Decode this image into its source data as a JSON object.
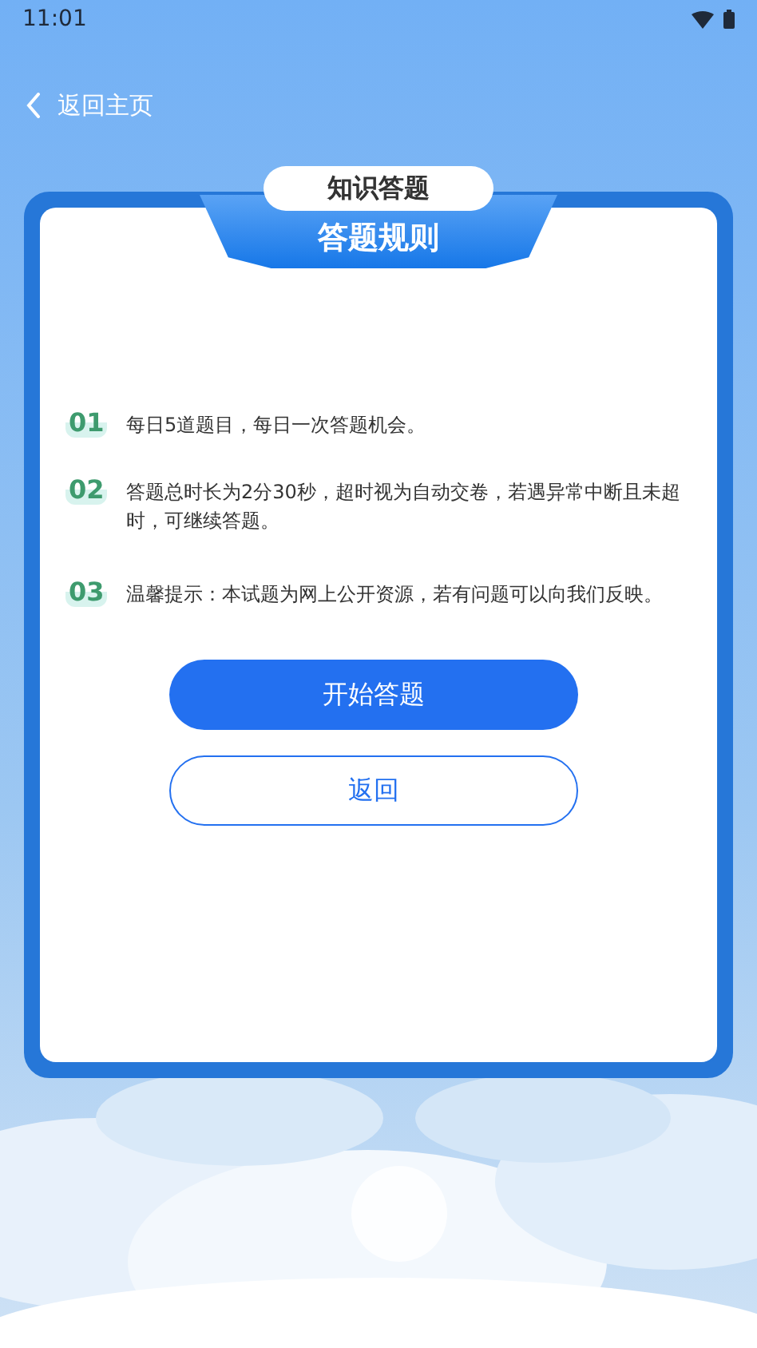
{
  "status_bar": {
    "time": "11:01"
  },
  "nav": {
    "back_label": "返回主页"
  },
  "card": {
    "badge": "知识答题",
    "title": "答题规则"
  },
  "rules": [
    {
      "number": "01",
      "text": "每日5道题目，每日一次答题机会。"
    },
    {
      "number": "02",
      "text": "答题总时长为2分30秒，超时视为自动交卷，若遇异常中断且未超时，可继续答题。"
    },
    {
      "number": "03",
      "text": "温馨提示：本试题为网上公开资源，若有问题可以向我们反映。"
    }
  ],
  "buttons": [
    {
      "label": "开始答题",
      "kind": "primary"
    },
    {
      "label": "返回",
      "kind": "outline"
    }
  ]
}
